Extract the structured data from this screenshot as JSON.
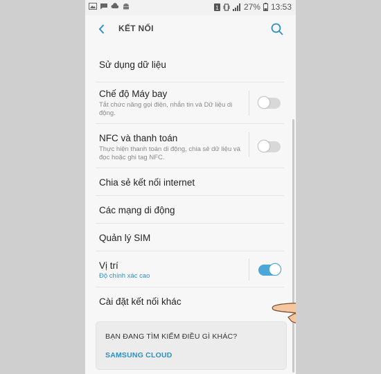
{
  "status": {
    "battery_percent": "27%",
    "time": "13:53",
    "left_icons": [
      "image-icon",
      "chat-icon",
      "cloud-icon",
      "android-icon"
    ],
    "right_icons": [
      "data-icon",
      "vibrate-icon",
      "signal-icon",
      "battery-icon"
    ]
  },
  "header": {
    "title": "KẾT NỐI"
  },
  "items": [
    {
      "label": "Sử dụng dữ liệu"
    },
    {
      "label": "Chế độ Máy bay",
      "sub": "Tắt chức năng gọi điện, nhắn tin và Dữ liệu di động.",
      "toggle": "off"
    },
    {
      "label": "NFC và thanh toán",
      "sub": "Thực hiện thanh toán di động, chia sẻ dữ liệu và đọc hoặc ghi tag NFC.",
      "toggle": "off"
    },
    {
      "label": "Chia sẻ kết nối internet"
    },
    {
      "label": "Các mạng di động"
    },
    {
      "label": "Quản lý SIM"
    },
    {
      "label": "Vị trí",
      "sub": "Độ chính xác cao",
      "toggle": "on"
    },
    {
      "label": "Cài đặt kết nối khác"
    }
  ],
  "card": {
    "title": "BẠN ĐANG TÌM KIẾM ĐIỀU GÌ KHÁC?",
    "link": "SAMSUNG CLOUD"
  },
  "colors": {
    "accent": "#2c8fc5",
    "toggle_on": "#4aa8d8",
    "background": "#f7f7f7"
  }
}
